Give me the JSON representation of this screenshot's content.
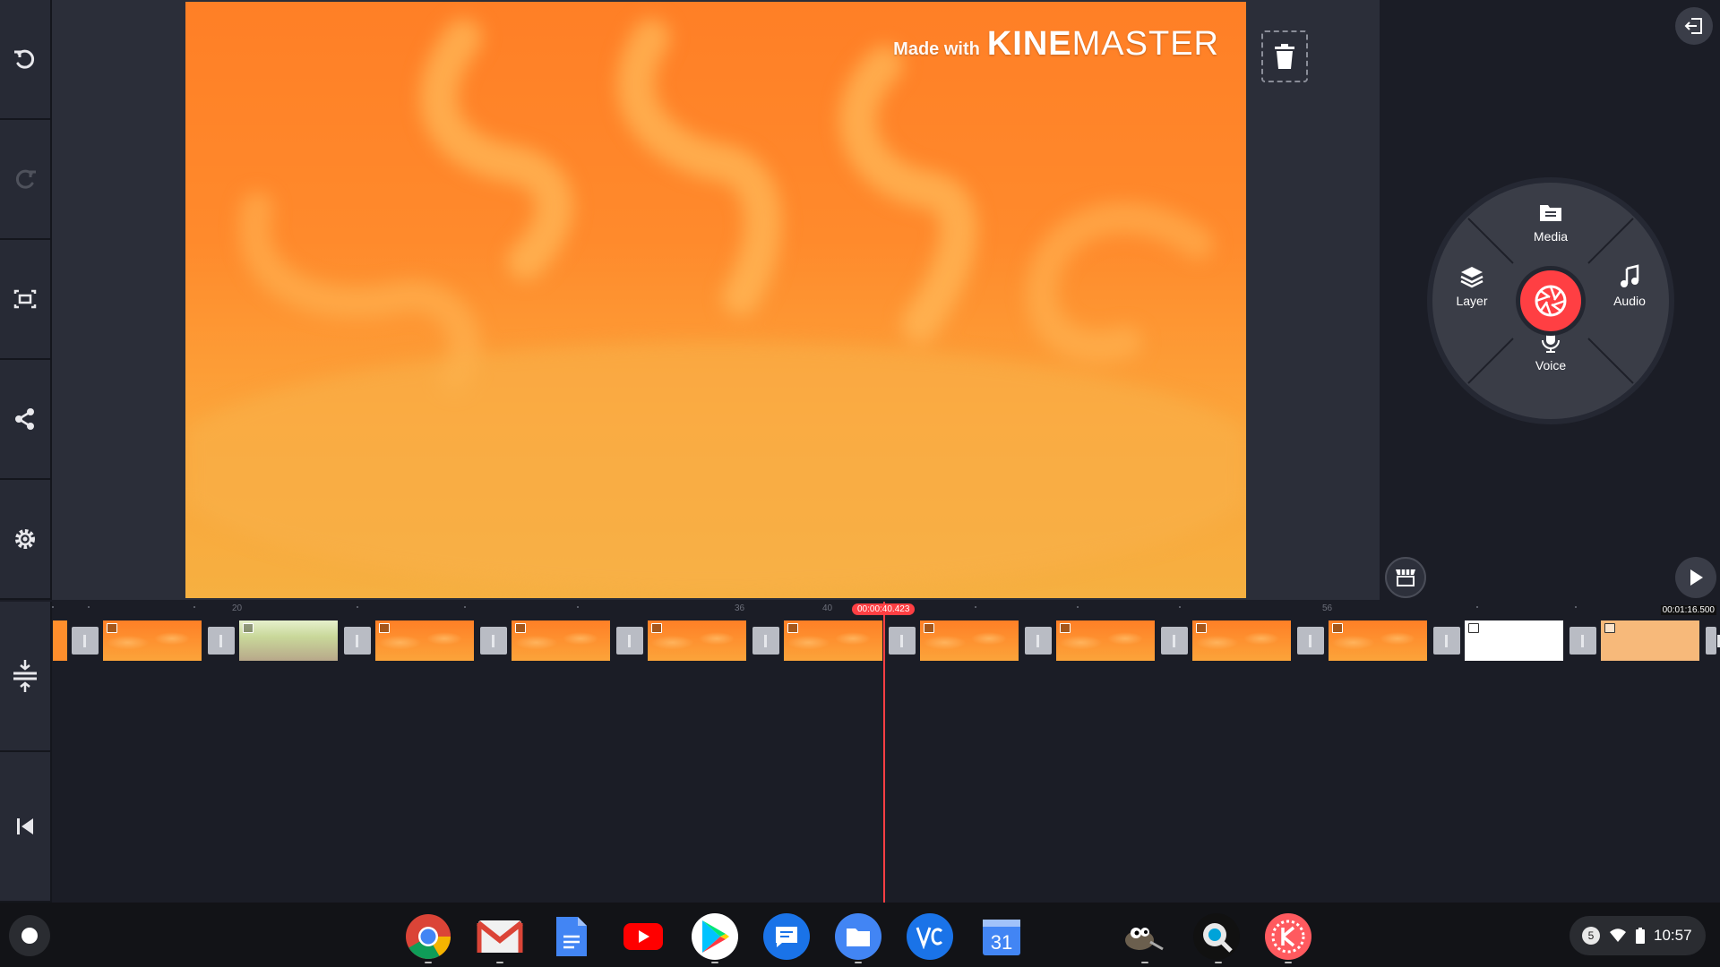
{
  "preview": {
    "watermark_prefix": "Made with",
    "watermark_brand_bold": "KINE",
    "watermark_brand_light": "MASTER"
  },
  "wheel": {
    "media_label": "Media",
    "layer_label": "Layer",
    "audio_label": "Audio",
    "voice_label": "Voice"
  },
  "timeline": {
    "playhead_time": "00:00:40.423",
    "end_time": "00:01:16.500",
    "ruler_labels": [
      "20",
      "36",
      "40",
      "56"
    ]
  },
  "tray": {
    "notification_count": "5",
    "time": "10:57"
  },
  "colors": {
    "accent": "#ff3f43",
    "background": "#1b1d26",
    "panel": "#272a35"
  }
}
